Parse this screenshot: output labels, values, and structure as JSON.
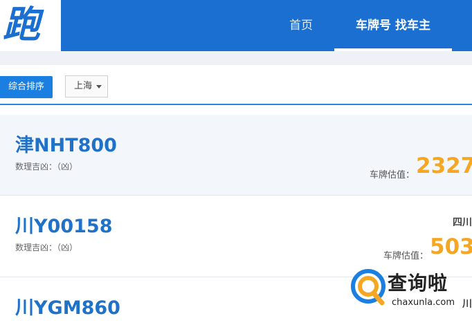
{
  "header": {
    "logo_char": "跑",
    "nav": [
      {
        "label": "首页"
      },
      {
        "label": "车牌号 找车主"
      }
    ]
  },
  "filters": {
    "sort_label": "综合排序",
    "city": "上海"
  },
  "plates": [
    {
      "plate": "津NHT800",
      "fortune": "数理吉凶：（凶）",
      "value_label": "车牌估值：",
      "value": "2327",
      "region": ""
    },
    {
      "plate": "川Y00158",
      "fortune": "数理吉凶：（凶）",
      "value_label": "车牌估值：",
      "value": "503",
      "region": "四川"
    },
    {
      "plate": "川YGM860",
      "fortune": "",
      "value_label": "",
      "value": "",
      "region": "川"
    }
  ],
  "watermark": {
    "title": "查询啦",
    "site": "chaxunla.com"
  },
  "colors": {
    "brand": "#1a6fd0",
    "accent_value": "#f5a623",
    "plate_text": "#1f72c8"
  }
}
